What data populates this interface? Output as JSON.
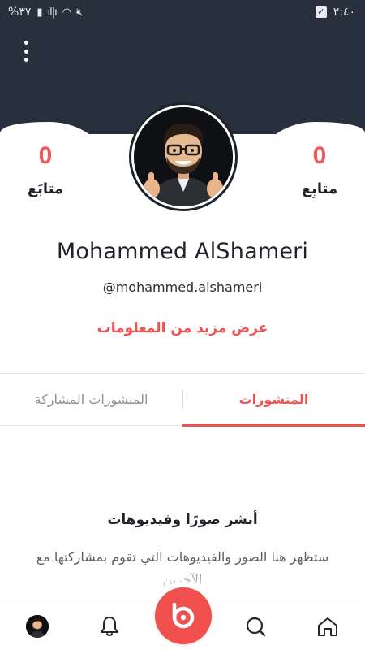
{
  "status_bar": {
    "battery": "%٣٧",
    "time": "٢:٤٠"
  },
  "profile": {
    "name": "Mohammed AlShameri",
    "handle": "@mohammed.alshameri",
    "more_info": "عرض مزيد من المعلومات"
  },
  "stats": {
    "left": {
      "value": "0",
      "label": "متابَع"
    },
    "right": {
      "value": "0",
      "label": "متابِع"
    }
  },
  "tabs": {
    "posts": "المنشورات",
    "shared": "المنشورات المشاركة",
    "active": "posts"
  },
  "empty_state": {
    "title": "أنشر صورًا وفيديوهات",
    "description": "ستظهر هنا الصور والفيديوهات التي تقوم بمشاركتها مع الآخرين"
  },
  "icons": {
    "menu": "kebab-menu-icon",
    "nav": [
      "profile-avatar",
      "bell-icon",
      "create-post-icon",
      "search-icon",
      "home-icon"
    ]
  },
  "colors": {
    "header": "#27303c",
    "accent": "#ef5352",
    "text": "#1f2328"
  }
}
